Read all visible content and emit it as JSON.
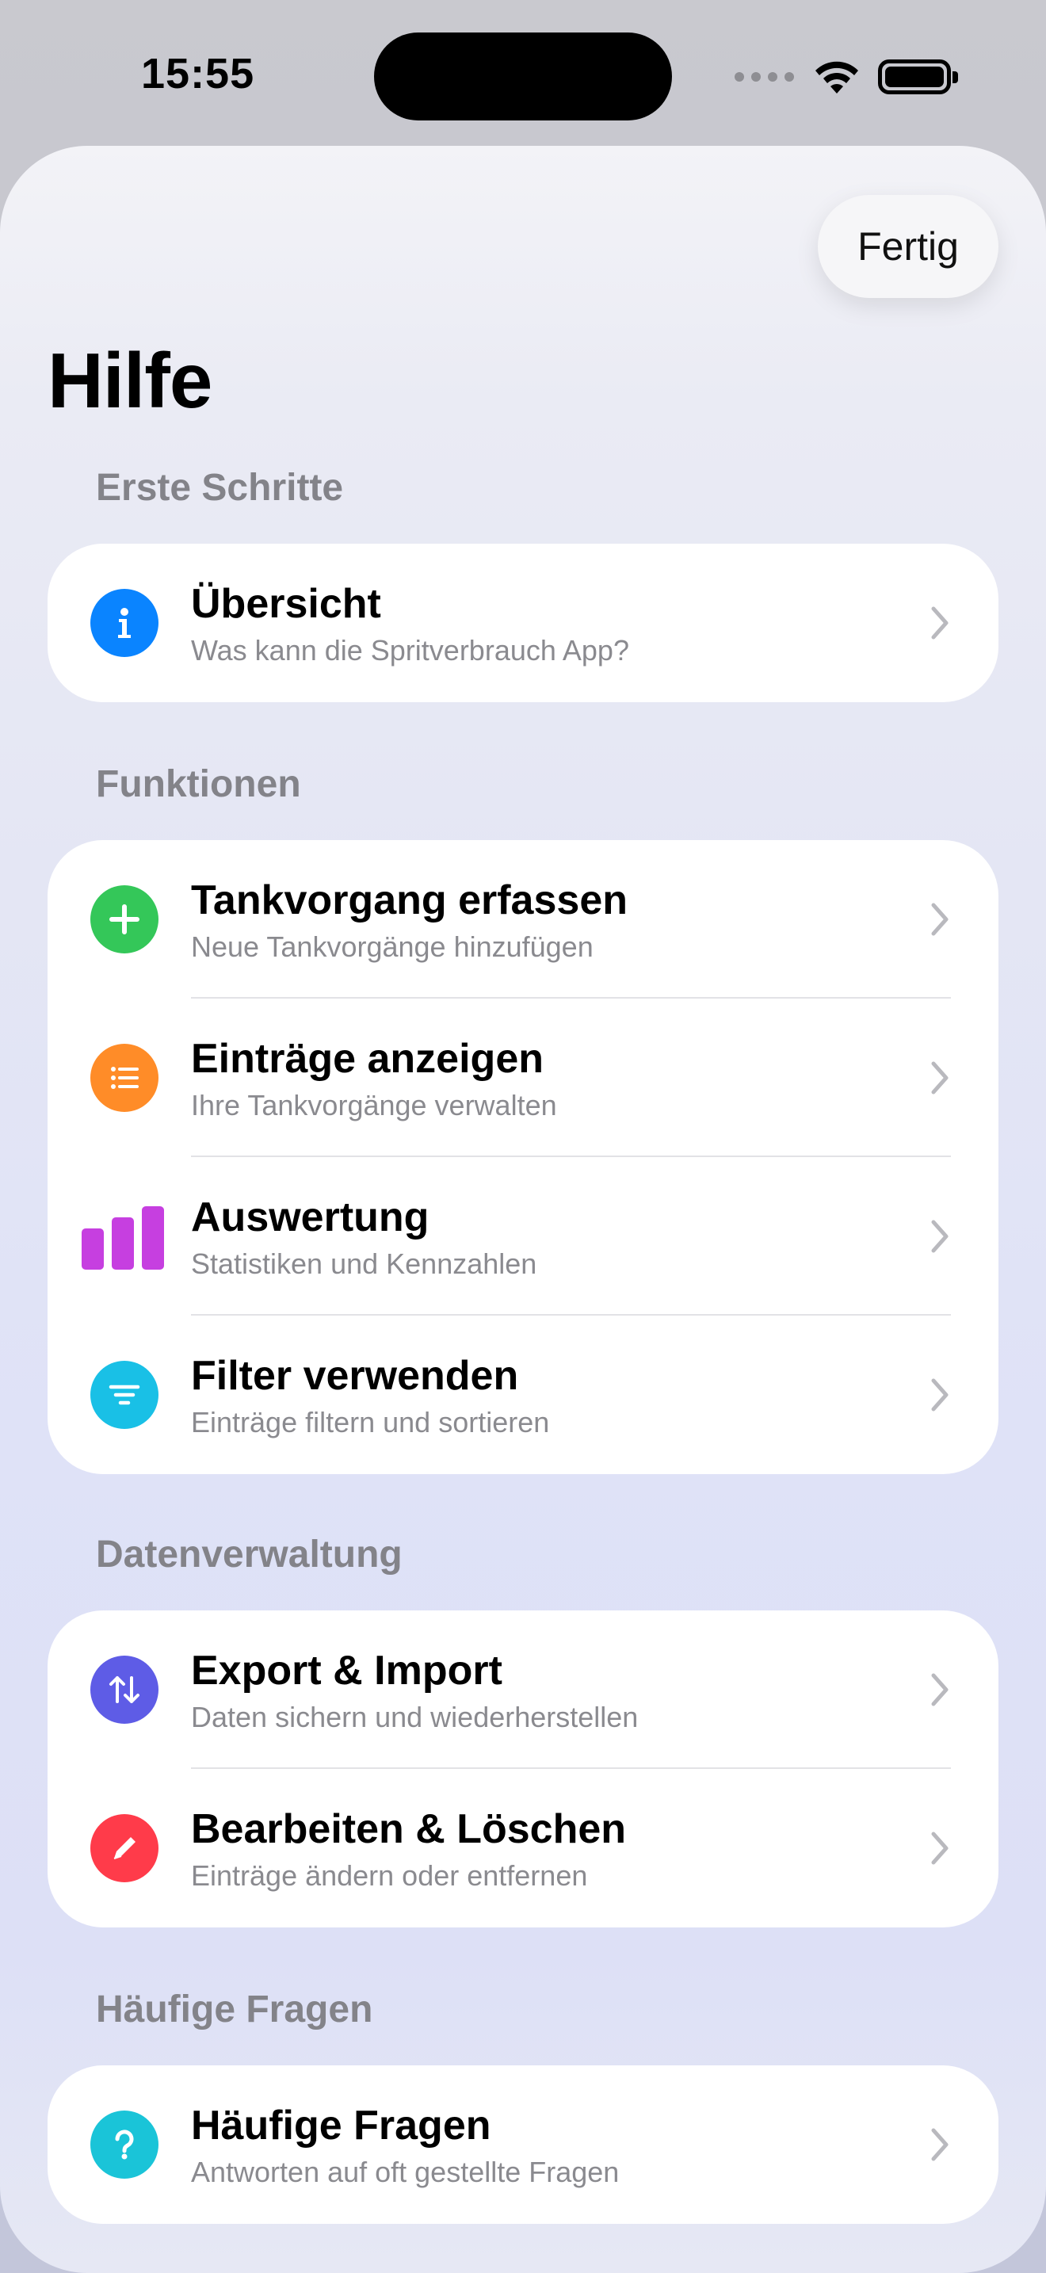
{
  "status_bar": {
    "time": "15:55"
  },
  "header": {
    "done_label": "Fertig",
    "title": "Hilfe"
  },
  "colors": {
    "info": "#0a84ff",
    "add": "#34c759",
    "list": "#ff8c28",
    "chart": "#c63fe0",
    "filter": "#19c0e6",
    "export": "#5e5ce6",
    "edit": "#ff3b4a",
    "faq": "#1ac4d8"
  },
  "sections": [
    {
      "header": "Erste Schritte",
      "items": [
        {
          "icon": "info-icon",
          "title": "Übersicht",
          "subtitle": "Was kann die Spritverbrauch App?"
        }
      ]
    },
    {
      "header": "Funktionen",
      "items": [
        {
          "icon": "plus-icon",
          "title": "Tankvorgang erfassen",
          "subtitle": "Neue Tankvorgänge hinzufügen"
        },
        {
          "icon": "list-icon",
          "title": "Einträge anzeigen",
          "subtitle": "Ihre Tankvorgänge verwalten"
        },
        {
          "icon": "bar-chart-icon",
          "title": "Auswertung",
          "subtitle": "Statistiken und Kennzahlen"
        },
        {
          "icon": "filter-icon",
          "title": "Filter verwenden",
          "subtitle": "Einträge filtern und sortieren"
        }
      ]
    },
    {
      "header": "Datenverwaltung",
      "items": [
        {
          "icon": "arrows-up-down-icon",
          "title": "Export & Import",
          "subtitle": "Daten sichern und wiederherstellen"
        },
        {
          "icon": "pencil-icon",
          "title": "Bearbeiten & Löschen",
          "subtitle": "Einträge ändern oder entfernen"
        }
      ]
    },
    {
      "header": "Häufige Fragen",
      "items": [
        {
          "icon": "question-icon",
          "title": "Häufige Fragen",
          "subtitle": "Antworten auf oft gestellte Fragen"
        }
      ]
    }
  ]
}
